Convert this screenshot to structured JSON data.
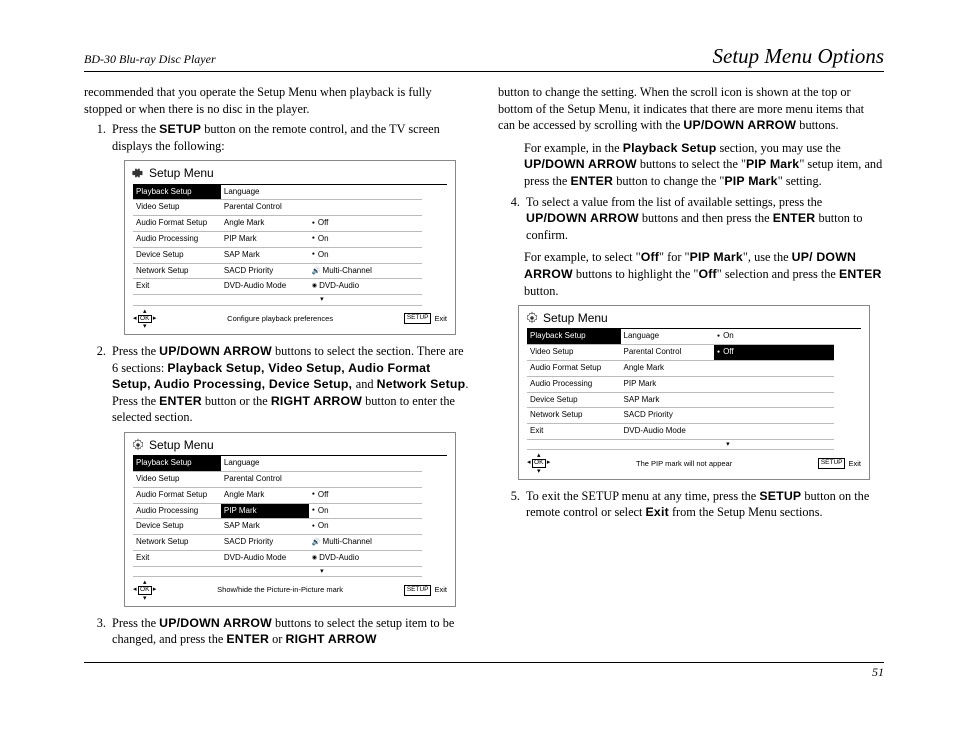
{
  "header": {
    "left": "BD-30 Blu-ray Disc Player",
    "right": "Setup Menu Options"
  },
  "page_number": "51",
  "col1": {
    "intro": "recommended that you operate the Setup Menu when playback is fully stopped or when there is no disc in the player.",
    "li1_a": "Press the ",
    "li1_b": "SETUP",
    "li1_c": " button on the remote control, and the TV screen displays the following:",
    "li2_a": "Press the ",
    "li2_b": "UP/DOWN ARROW",
    "li2_c": " buttons to select the section. There are 6 sections: ",
    "li2_list": "Playback Setup, Video Setup, Audio Format Setup, Audio Processing, Device Setup, ",
    "li2_and": "and ",
    "li2_net": "Network Setup",
    "li2_d": ". Press the ",
    "li2_e": "ENTER",
    "li2_f": " button or the ",
    "li2_g": "RIGHT ARROW",
    "li2_h": " button to enter the selected section.",
    "li3_a": "Press the ",
    "li3_b": "UP/DOWN ARROW",
    "li3_c": " buttons to select the setup item to be changed, and press the ",
    "li3_d": "ENTER",
    "li3_e": " or ",
    "li3_f": "RIGHT ARROW"
  },
  "col2": {
    "p1_a": "button to change the setting. When the scroll icon is shown at the top or bottom of the Setup Menu, it indicates that there are more menu items that can be accessed by scrolling with the ",
    "p1_b": "UP/DOWN ARROW",
    "p1_c": " buttons.",
    "ind1_a": "For example, in the ",
    "ind1_b": "Playback Setup",
    "ind1_c": " section, you may use the ",
    "ind1_d": "UP/DOWN ARROW",
    "ind1_e": " buttons to select the \"",
    "ind1_f": "PIP Mark",
    "ind1_g": "\" setup item, and press the ",
    "ind1_h": "ENTER",
    "ind1_i": " button to change the \"",
    "ind1_j": "PIP Mark",
    "ind1_k": "\" setting.",
    "li4_a": "To select a value from the list of available settings, press the ",
    "li4_b": "UP/DOWN ARROW",
    "li4_c": " buttons and then press the ",
    "li4_d": "ENTER",
    "li4_e": " button to confirm.",
    "ind2_a": "For example, to select \"",
    "ind2_b": "Off",
    "ind2_c": "\" for \"",
    "ind2_d": "PIP Mark",
    "ind2_e": "\", use the ",
    "ind2_f": "UP/ DOWN ARROW",
    "ind2_g": " buttons to highlight the \"",
    "ind2_h": "Off",
    "ind2_i": "\" selection and press the ",
    "ind2_j": "ENTER",
    "ind2_k": " button.",
    "li5_a": "To exit the SETUP menu at any time, press the ",
    "li5_b": "SETUP",
    "li5_c": " button on the remote control or select ",
    "li5_d": "Exit",
    "li5_e": " from the Setup Menu sections."
  },
  "osd": {
    "title": "Setup Menu",
    "sections": [
      "Playback Setup",
      "Video Setup",
      "Audio Format Setup",
      "Audio Processing",
      "Device Setup",
      "Network Setup",
      "Exit"
    ],
    "items": [
      "Language",
      "Parental Control",
      "Angle Mark",
      "PIP Mark",
      "SAP Mark",
      "SACD Priority",
      "DVD-Audio Mode"
    ],
    "vals1": [
      "",
      "",
      "Off",
      "On",
      "On",
      "Multi-Channel",
      "DVD-Audio"
    ],
    "vals3": [
      "On",
      "Off",
      "",
      "",
      "",
      "",
      ""
    ],
    "hint1": "Configure playback preferences",
    "hint2": "Show/hide the Picture-in-Picture mark",
    "hint3": "The PIP mark will not appear",
    "setup_btn": "SETUP",
    "exit": "Exit",
    "ok": "OK"
  }
}
